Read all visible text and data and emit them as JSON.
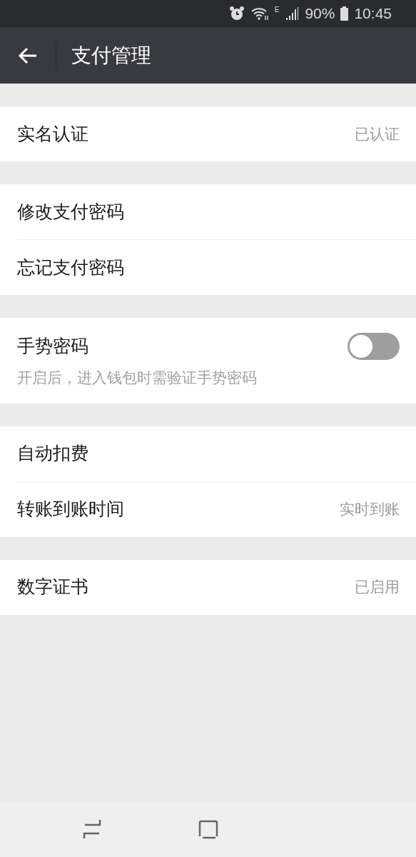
{
  "status_bar": {
    "network": "E",
    "battery": "90%",
    "time": "10:45"
  },
  "header": {
    "title": "支付管理"
  },
  "groups": [
    {
      "items": [
        {
          "kind": "link",
          "label": "实名认证",
          "value": "已认证"
        }
      ]
    },
    {
      "items": [
        {
          "kind": "link",
          "label": "修改支付密码"
        },
        {
          "kind": "link",
          "label": "忘记支付密码"
        }
      ]
    },
    {
      "items": [
        {
          "kind": "toggle",
          "label": "手势密码",
          "on": false,
          "description": "开启后，进入钱包时需验证手势密码"
        }
      ]
    },
    {
      "items": [
        {
          "kind": "link",
          "label": "自动扣费"
        },
        {
          "kind": "link",
          "label": "转账到账时间",
          "value": "实时到账"
        }
      ]
    },
    {
      "items": [
        {
          "kind": "link",
          "label": "数字证书",
          "value": "已启用"
        }
      ]
    }
  ]
}
